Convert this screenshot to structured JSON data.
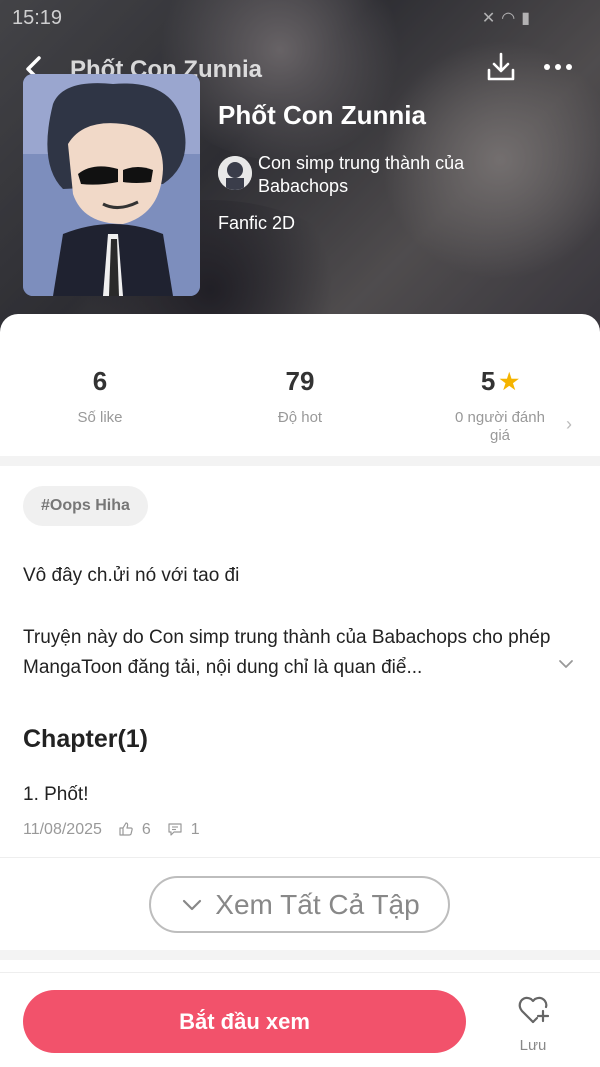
{
  "status_bar": {
    "time": "15:19"
  },
  "header": {
    "nav_title": "Phốt Con Zunnia"
  },
  "story": {
    "title": "Phốt Con Zunnia",
    "author": "Con simp trung thành của Babachops",
    "genre": "Fanfic 2D"
  },
  "stats": [
    {
      "value": "6",
      "label": "Số like"
    },
    {
      "value": "79",
      "label": "Độ hot"
    },
    {
      "value": "5",
      "label": "0 người đánh giá"
    }
  ],
  "tag": "#Oops Hiha",
  "description": {
    "line1": "Vô đây ch.ửi nó với tao đi",
    "line2": "Truyện này do Con simp trung thành của Babachops cho phép MangaToon đăng tải, nội dung chỉ là quan điể..."
  },
  "chapters": {
    "heading": "Chapter(1)",
    "items": [
      {
        "title": "1. Phốt!",
        "date": "11/08/2025",
        "likes": "6",
        "comments": "1"
      }
    ]
  },
  "see_all_label": "Xem Tất Cả Tập",
  "bottom": {
    "start_label": "Bắt đầu xem",
    "save_label": "Lưu"
  },
  "colors": {
    "accent": "#f2526b",
    "star": "#f5b400"
  }
}
